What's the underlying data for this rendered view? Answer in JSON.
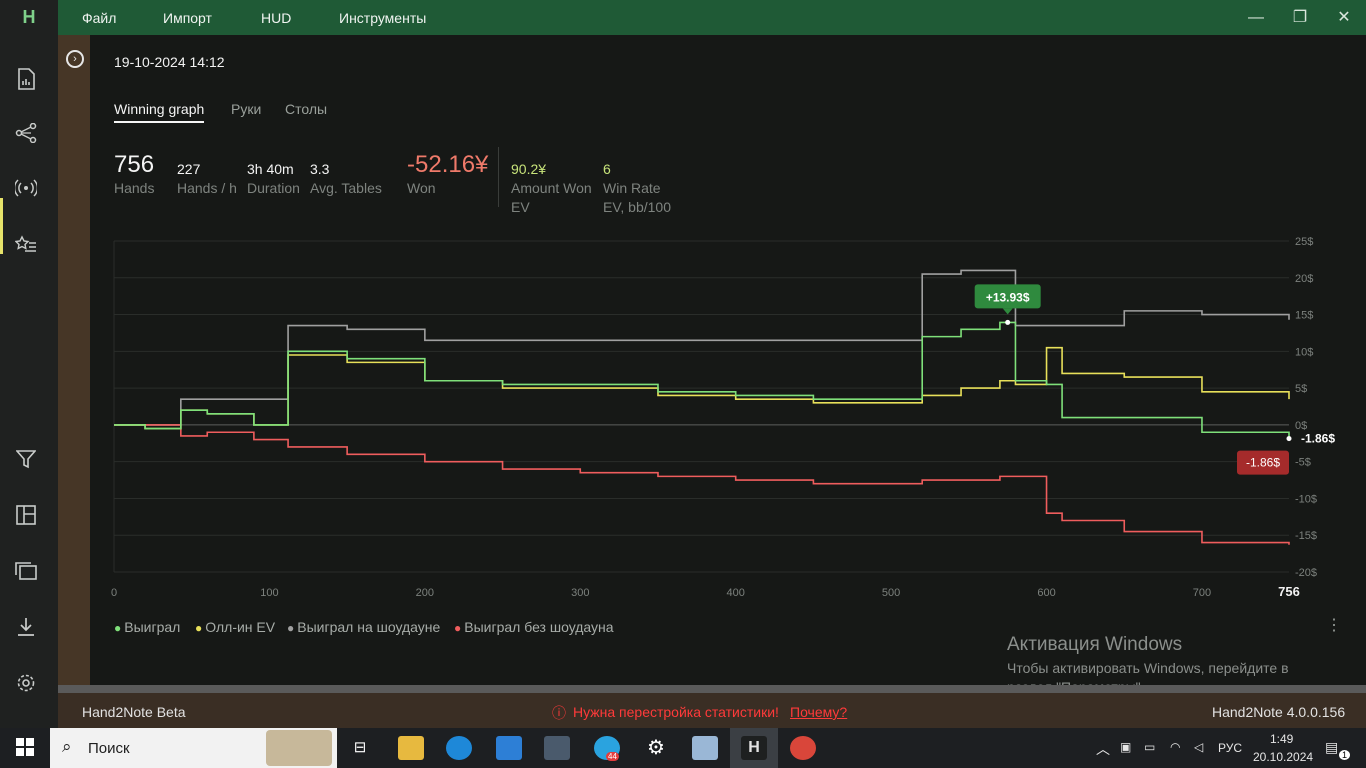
{
  "menu": {
    "items": [
      "Файл",
      "Импорт",
      "HUD",
      "Инструменты"
    ]
  },
  "session": {
    "datetime": "19-10-2024 14:12"
  },
  "tabs": [
    "Winning graph",
    "Руки",
    "Столы"
  ],
  "stats": {
    "hands": {
      "value": "756",
      "label": "Hands"
    },
    "hands_per_h": {
      "value": "227",
      "label": "Hands / h"
    },
    "duration": {
      "value": "3h 40m",
      "label": "Duration"
    },
    "avg_tables": {
      "value": "3.3",
      "label": "Avg. Tables"
    },
    "won": {
      "value": "-52.16¥",
      "label": "Won"
    },
    "amount_won_ev": {
      "value": "90.2¥",
      "label": "Amount Won EV"
    },
    "win_rate_ev": {
      "value": "6",
      "label": "Win Rate EV, bb/100"
    }
  },
  "chart_data": {
    "type": "line",
    "x": [
      0,
      20,
      43,
      60,
      90,
      112,
      150,
      200,
      250,
      300,
      350,
      400,
      450,
      500,
      520,
      545,
      570,
      580,
      600,
      610,
      650,
      700,
      756
    ],
    "xlim": [
      0,
      756
    ],
    "x_ticks": [
      "0",
      "100",
      "200",
      "300",
      "400",
      "500",
      "600",
      "700"
    ],
    "x_end_label": "756",
    "ylim": [
      -20,
      25
    ],
    "y_ticks": [
      "25$",
      "20$",
      "15$",
      "10$",
      "5$",
      "0$",
      "-5$",
      "-10$",
      "-15$",
      "-20$"
    ],
    "series": [
      {
        "name": "Выиграл",
        "color": "#7fe07a",
        "values": [
          0,
          -0.5,
          2,
          1.5,
          0,
          10,
          9,
          6,
          5.5,
          5.5,
          4.5,
          4,
          3.5,
          3.5,
          12,
          13,
          13.93,
          6,
          5.5,
          1,
          1,
          -1,
          -1.86
        ]
      },
      {
        "name": "Олл-ин EV",
        "color": "#e8e05a",
        "values": [
          0,
          -0.5,
          2,
          1.5,
          0,
          9.5,
          8.5,
          6,
          5,
          5,
          4,
          3.5,
          3,
          3,
          4,
          5,
          6,
          5.5,
          10.5,
          7,
          6.5,
          4.5,
          3.5
        ]
      },
      {
        "name": "Выиграл на шоудауне",
        "color": "#a0a0a0",
        "values": [
          0,
          0,
          3.5,
          3.5,
          3.5,
          13.5,
          13,
          11.5,
          11.5,
          11.5,
          11.5,
          11.5,
          11.5,
          11.5,
          20.5,
          21,
          21,
          13.5,
          13.5,
          13.5,
          15.5,
          15,
          14.3
        ]
      },
      {
        "name": "Выиграл без шоудауна",
        "color": "#ef5d5d",
        "values": [
          0,
          0,
          -1.5,
          -1,
          -2,
          -3,
          -4,
          -5,
          -6,
          -6.5,
          -7,
          -7.5,
          -8,
          -8,
          -7.5,
          -7.5,
          -7,
          -7,
          -12,
          -13,
          -14.5,
          -16,
          -16.3
        ]
      }
    ],
    "annotations": {
      "peak": "+13.93$",
      "end_green": "-1.86$",
      "end_red": "-1.86$"
    }
  },
  "activation": {
    "title": "Активация Windows",
    "text1": "Чтобы активировать Windows, перейдите в",
    "text2": "раздел \"Параметры\"."
  },
  "statusbar": {
    "left": "Hand2Note Beta",
    "warning": "Нужна перестройка статистики!",
    "link": "Почему?",
    "version": "Hand2Note 4.0.0.156"
  },
  "taskbar": {
    "search_placeholder": "Поиск",
    "lang": "РУС",
    "time": "1:49",
    "date": "20.10.2024",
    "notifications": "1",
    "telegram_badge": "44"
  }
}
